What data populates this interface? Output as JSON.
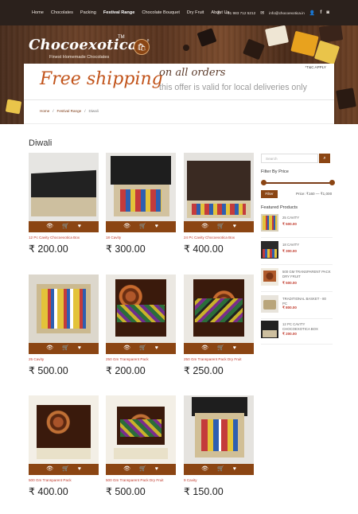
{
  "nav": {
    "links": [
      "Home",
      "Chocolates",
      "Packing",
      "Festival Range",
      "Chocolate Bouquet",
      "Dry Fruit",
      "About Us"
    ],
    "active_index": 3,
    "phone": "+91 983 712 5212",
    "email": "info@chocoexotica.in"
  },
  "brand": {
    "name": "Chocoexotica",
    "tm": "TM",
    "tagline": "Finest Homemade Chocolates",
    "cart_count": "0"
  },
  "banner": {
    "headline": "Free shipping",
    "sub": "on all orders",
    "note": "this offer is valid for local deliveries only",
    "tc": "*T&C APPLY"
  },
  "breadcrumb": [
    "Home",
    "Festival Range",
    "Diwali"
  ],
  "page_title": "Diwali",
  "products": [
    {
      "name": "12 Pc Cavity Chocoexotica Box",
      "price": "₹ 200.00"
    },
    {
      "name": "18 Cavity",
      "price": "₹ 300.00"
    },
    {
      "name": "24 Pc Cavity Chocoexotica Box",
      "price": "₹ 400.00"
    },
    {
      "name": "25 Cavity",
      "price": "₹ 500.00"
    },
    {
      "name": "250 Gm Transparent Pack",
      "price": "₹ 200.00"
    },
    {
      "name": "250 Gm Transparent Pack Dry Fruit",
      "price": "₹ 250.00"
    },
    {
      "name": "500 Gm Transparent Pack",
      "price": "₹ 400.00"
    },
    {
      "name": "500 Gm Transparent Pack Dry Fruit",
      "price": "₹ 500.00"
    },
    {
      "name": "9 Cavity",
      "price": "₹ 150.00"
    }
  ],
  "sidebar": {
    "search_placeholder": "Search",
    "filter_title": "Filter By Price",
    "filter_button": "Filter",
    "price_range": "Price: ₹160 — ₹1,000",
    "featured_title": "Featured Products",
    "featured": [
      {
        "name": "25 CAVITY",
        "price": "₹ 500.00"
      },
      {
        "name": "18 CAVITY",
        "price": "₹ 300.00"
      },
      {
        "name": "500 GM TRANSPARENT PACK DRY FRUIT",
        "price": "₹ 500.00"
      },
      {
        "name": "TRADITIONAL BASKET - 80 PC",
        "price": "₹ 800.00"
      },
      {
        "name": "12 PC CAVITY CHOCOEXOTICA BOX",
        "price": "₹ 200.00"
      }
    ]
  },
  "colors": {
    "brand_brown": "#8b4513",
    "price_red": "#c0392b",
    "banner_orange": "#c2541b"
  }
}
